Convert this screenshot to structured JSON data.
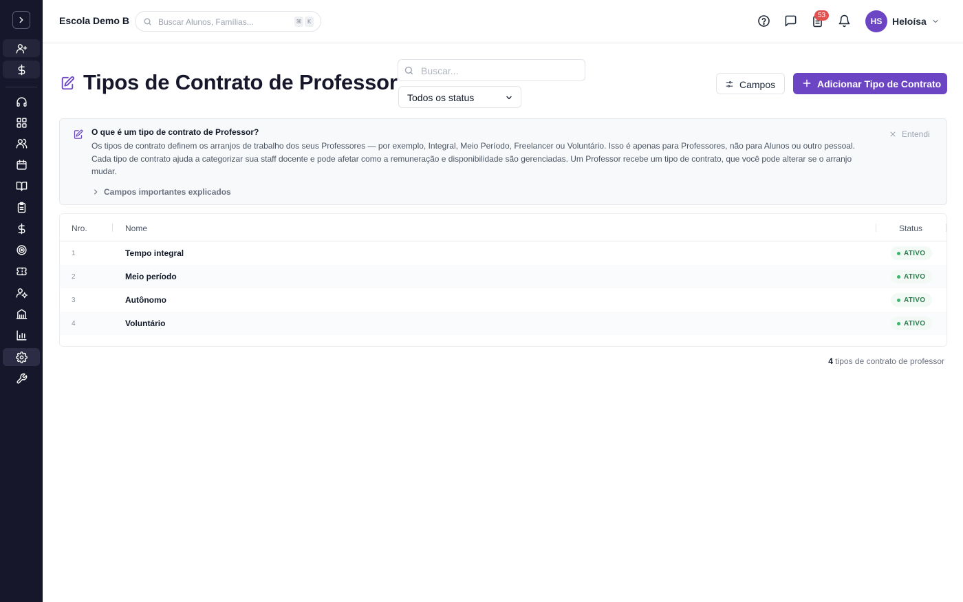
{
  "app": {
    "school_name": "Escola Demo B",
    "global_search_placeholder": "Buscar Alunos, Famílias...",
    "shortcut_keys": [
      "⌘",
      "K"
    ],
    "notification_count": "53",
    "user_initials": "HS",
    "user_name": "Heloísa"
  },
  "page": {
    "title": "Tipos de Contrato de Professor",
    "search_placeholder": "Buscar...",
    "status_filter": "Todos os status",
    "fields_button": "Campos",
    "add_button": "Adicionar Tipo de Contrato"
  },
  "info": {
    "title": "O que é um tipo de contrato de Professor?",
    "body": "Os tipos de contrato definem os arranjos de trabalho dos seus Professores — por exemplo, Integral, Meio Período, Freelancer ou Voluntário. Isso é apenas para Professores, não para Alunos ou outro pessoal. Cada tipo de contrato ajuda a categorizar sua staff docente e pode afetar como a remuneração e disponibilidade são gerenciadas. Um Professor recebe um tipo de contrato, que você pode alterar se o arranjo mudar.",
    "dismiss": "Entendi",
    "expand": "Campos importantes explicados"
  },
  "table": {
    "columns": [
      "Nro.",
      "Nome",
      "Status"
    ],
    "rows": [
      {
        "num": "1",
        "name": "Tempo integral",
        "status": "ATIVO"
      },
      {
        "num": "2",
        "name": "Meio período",
        "status": "ATIVO"
      },
      {
        "num": "3",
        "name": "Autônomo",
        "status": "ATIVO"
      },
      {
        "num": "4",
        "name": "Voluntário",
        "status": "ATIVO"
      }
    ]
  },
  "footer": {
    "count": "4",
    "label": "tipos de contrato de professor"
  },
  "colors": {
    "sidebar_bg": "#17172b",
    "accent": "#6b45c4",
    "status_active": "#3eb46e",
    "badge_red": "#e05252"
  },
  "sidebar_icons": [
    "user-plus-icon",
    "dollar-icon",
    "headset-icon",
    "grid-icon",
    "users-icon",
    "calendar-icon",
    "book-icon",
    "clipboard-icon",
    "dollar-icon",
    "target-icon",
    "ticket-icon",
    "user-settings-icon",
    "building-icon",
    "bar-chart-icon",
    "gear-icon",
    "wrench-icon"
  ]
}
